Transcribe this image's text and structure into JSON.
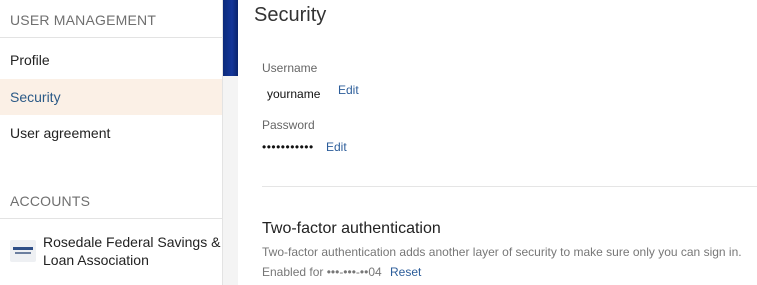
{
  "sidebar": {
    "user_management_title": "USER MANAGEMENT",
    "items": [
      {
        "label": "Profile"
      },
      {
        "label": "Security"
      },
      {
        "label": "User agreement"
      }
    ],
    "accounts_title": "ACCOUNTS",
    "account": {
      "name": "Rosedale Federal Savings & Loan Association",
      "logo": "bank-logo-icon"
    }
  },
  "main": {
    "title": "Security",
    "username_label": "Username",
    "username_value": "yourname",
    "username_edit": "Edit",
    "password_label": "Password",
    "password_value": "•••••••••••",
    "password_edit": "Edit",
    "tfa_title": "Two-factor authentication",
    "tfa_description": "Two-factor authentication adds another layer of security to make sure only you can sign in.",
    "tfa_enabled_for": "Enabled for •••-•••-••04",
    "tfa_reset": "Reset"
  },
  "colors": {
    "active_bg": "#fbf0e6",
    "link": "#2c5d9a",
    "scroll_thumb": "#0b2a7a"
  }
}
